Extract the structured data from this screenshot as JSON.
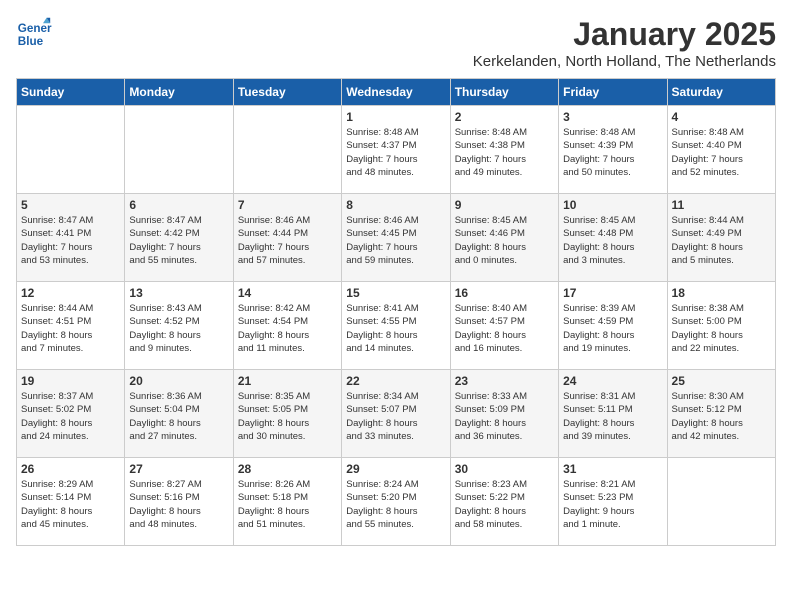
{
  "logo": {
    "line1": "General",
    "line2": "Blue"
  },
  "title": "January 2025",
  "subtitle": "Kerkelanden, North Holland, The Netherlands",
  "weekdays": [
    "Sunday",
    "Monday",
    "Tuesday",
    "Wednesday",
    "Thursday",
    "Friday",
    "Saturday"
  ],
  "weeks": [
    [
      {
        "day": "",
        "info": ""
      },
      {
        "day": "",
        "info": ""
      },
      {
        "day": "",
        "info": ""
      },
      {
        "day": "1",
        "info": "Sunrise: 8:48 AM\nSunset: 4:37 PM\nDaylight: 7 hours\nand 48 minutes."
      },
      {
        "day": "2",
        "info": "Sunrise: 8:48 AM\nSunset: 4:38 PM\nDaylight: 7 hours\nand 49 minutes."
      },
      {
        "day": "3",
        "info": "Sunrise: 8:48 AM\nSunset: 4:39 PM\nDaylight: 7 hours\nand 50 minutes."
      },
      {
        "day": "4",
        "info": "Sunrise: 8:48 AM\nSunset: 4:40 PM\nDaylight: 7 hours\nand 52 minutes."
      }
    ],
    [
      {
        "day": "5",
        "info": "Sunrise: 8:47 AM\nSunset: 4:41 PM\nDaylight: 7 hours\nand 53 minutes."
      },
      {
        "day": "6",
        "info": "Sunrise: 8:47 AM\nSunset: 4:42 PM\nDaylight: 7 hours\nand 55 minutes."
      },
      {
        "day": "7",
        "info": "Sunrise: 8:46 AM\nSunset: 4:44 PM\nDaylight: 7 hours\nand 57 minutes."
      },
      {
        "day": "8",
        "info": "Sunrise: 8:46 AM\nSunset: 4:45 PM\nDaylight: 7 hours\nand 59 minutes."
      },
      {
        "day": "9",
        "info": "Sunrise: 8:45 AM\nSunset: 4:46 PM\nDaylight: 8 hours\nand 0 minutes."
      },
      {
        "day": "10",
        "info": "Sunrise: 8:45 AM\nSunset: 4:48 PM\nDaylight: 8 hours\nand 3 minutes."
      },
      {
        "day": "11",
        "info": "Sunrise: 8:44 AM\nSunset: 4:49 PM\nDaylight: 8 hours\nand 5 minutes."
      }
    ],
    [
      {
        "day": "12",
        "info": "Sunrise: 8:44 AM\nSunset: 4:51 PM\nDaylight: 8 hours\nand 7 minutes."
      },
      {
        "day": "13",
        "info": "Sunrise: 8:43 AM\nSunset: 4:52 PM\nDaylight: 8 hours\nand 9 minutes."
      },
      {
        "day": "14",
        "info": "Sunrise: 8:42 AM\nSunset: 4:54 PM\nDaylight: 8 hours\nand 11 minutes."
      },
      {
        "day": "15",
        "info": "Sunrise: 8:41 AM\nSunset: 4:55 PM\nDaylight: 8 hours\nand 14 minutes."
      },
      {
        "day": "16",
        "info": "Sunrise: 8:40 AM\nSunset: 4:57 PM\nDaylight: 8 hours\nand 16 minutes."
      },
      {
        "day": "17",
        "info": "Sunrise: 8:39 AM\nSunset: 4:59 PM\nDaylight: 8 hours\nand 19 minutes."
      },
      {
        "day": "18",
        "info": "Sunrise: 8:38 AM\nSunset: 5:00 PM\nDaylight: 8 hours\nand 22 minutes."
      }
    ],
    [
      {
        "day": "19",
        "info": "Sunrise: 8:37 AM\nSunset: 5:02 PM\nDaylight: 8 hours\nand 24 minutes."
      },
      {
        "day": "20",
        "info": "Sunrise: 8:36 AM\nSunset: 5:04 PM\nDaylight: 8 hours\nand 27 minutes."
      },
      {
        "day": "21",
        "info": "Sunrise: 8:35 AM\nSunset: 5:05 PM\nDaylight: 8 hours\nand 30 minutes."
      },
      {
        "day": "22",
        "info": "Sunrise: 8:34 AM\nSunset: 5:07 PM\nDaylight: 8 hours\nand 33 minutes."
      },
      {
        "day": "23",
        "info": "Sunrise: 8:33 AM\nSunset: 5:09 PM\nDaylight: 8 hours\nand 36 minutes."
      },
      {
        "day": "24",
        "info": "Sunrise: 8:31 AM\nSunset: 5:11 PM\nDaylight: 8 hours\nand 39 minutes."
      },
      {
        "day": "25",
        "info": "Sunrise: 8:30 AM\nSunset: 5:12 PM\nDaylight: 8 hours\nand 42 minutes."
      }
    ],
    [
      {
        "day": "26",
        "info": "Sunrise: 8:29 AM\nSunset: 5:14 PM\nDaylight: 8 hours\nand 45 minutes."
      },
      {
        "day": "27",
        "info": "Sunrise: 8:27 AM\nSunset: 5:16 PM\nDaylight: 8 hours\nand 48 minutes."
      },
      {
        "day": "28",
        "info": "Sunrise: 8:26 AM\nSunset: 5:18 PM\nDaylight: 8 hours\nand 51 minutes."
      },
      {
        "day": "29",
        "info": "Sunrise: 8:24 AM\nSunset: 5:20 PM\nDaylight: 8 hours\nand 55 minutes."
      },
      {
        "day": "30",
        "info": "Sunrise: 8:23 AM\nSunset: 5:22 PM\nDaylight: 8 hours\nand 58 minutes."
      },
      {
        "day": "31",
        "info": "Sunrise: 8:21 AM\nSunset: 5:23 PM\nDaylight: 9 hours\nand 1 minute."
      },
      {
        "day": "",
        "info": ""
      }
    ]
  ]
}
